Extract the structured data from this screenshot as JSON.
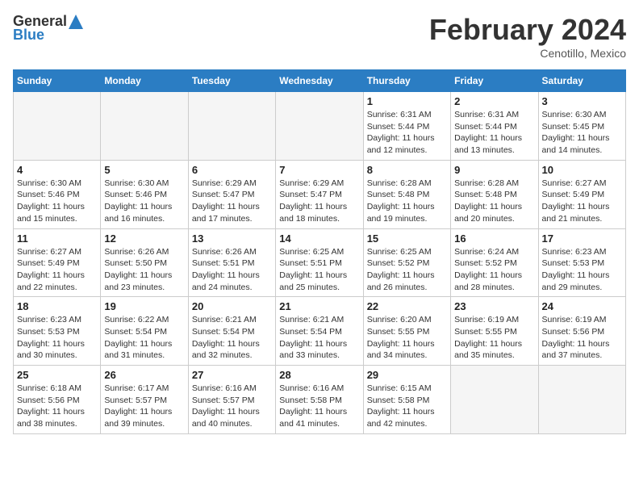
{
  "header": {
    "logo_general": "General",
    "logo_blue": "Blue",
    "month_title": "February 2024",
    "subtitle": "Cenotillo, Mexico"
  },
  "days_of_week": [
    "Sunday",
    "Monday",
    "Tuesday",
    "Wednesday",
    "Thursday",
    "Friday",
    "Saturday"
  ],
  "weeks": [
    [
      {
        "day": "",
        "info": ""
      },
      {
        "day": "",
        "info": ""
      },
      {
        "day": "",
        "info": ""
      },
      {
        "day": "",
        "info": ""
      },
      {
        "day": "1",
        "info": "Sunrise: 6:31 AM\nSunset: 5:44 PM\nDaylight: 11 hours and 12 minutes."
      },
      {
        "day": "2",
        "info": "Sunrise: 6:31 AM\nSunset: 5:44 PM\nDaylight: 11 hours and 13 minutes."
      },
      {
        "day": "3",
        "info": "Sunrise: 6:30 AM\nSunset: 5:45 PM\nDaylight: 11 hours and 14 minutes."
      }
    ],
    [
      {
        "day": "4",
        "info": "Sunrise: 6:30 AM\nSunset: 5:46 PM\nDaylight: 11 hours and 15 minutes."
      },
      {
        "day": "5",
        "info": "Sunrise: 6:30 AM\nSunset: 5:46 PM\nDaylight: 11 hours and 16 minutes."
      },
      {
        "day": "6",
        "info": "Sunrise: 6:29 AM\nSunset: 5:47 PM\nDaylight: 11 hours and 17 minutes."
      },
      {
        "day": "7",
        "info": "Sunrise: 6:29 AM\nSunset: 5:47 PM\nDaylight: 11 hours and 18 minutes."
      },
      {
        "day": "8",
        "info": "Sunrise: 6:28 AM\nSunset: 5:48 PM\nDaylight: 11 hours and 19 minutes."
      },
      {
        "day": "9",
        "info": "Sunrise: 6:28 AM\nSunset: 5:48 PM\nDaylight: 11 hours and 20 minutes."
      },
      {
        "day": "10",
        "info": "Sunrise: 6:27 AM\nSunset: 5:49 PM\nDaylight: 11 hours and 21 minutes."
      }
    ],
    [
      {
        "day": "11",
        "info": "Sunrise: 6:27 AM\nSunset: 5:49 PM\nDaylight: 11 hours and 22 minutes."
      },
      {
        "day": "12",
        "info": "Sunrise: 6:26 AM\nSunset: 5:50 PM\nDaylight: 11 hours and 23 minutes."
      },
      {
        "day": "13",
        "info": "Sunrise: 6:26 AM\nSunset: 5:51 PM\nDaylight: 11 hours and 24 minutes."
      },
      {
        "day": "14",
        "info": "Sunrise: 6:25 AM\nSunset: 5:51 PM\nDaylight: 11 hours and 25 minutes."
      },
      {
        "day": "15",
        "info": "Sunrise: 6:25 AM\nSunset: 5:52 PM\nDaylight: 11 hours and 26 minutes."
      },
      {
        "day": "16",
        "info": "Sunrise: 6:24 AM\nSunset: 5:52 PM\nDaylight: 11 hours and 28 minutes."
      },
      {
        "day": "17",
        "info": "Sunrise: 6:23 AM\nSunset: 5:53 PM\nDaylight: 11 hours and 29 minutes."
      }
    ],
    [
      {
        "day": "18",
        "info": "Sunrise: 6:23 AM\nSunset: 5:53 PM\nDaylight: 11 hours and 30 minutes."
      },
      {
        "day": "19",
        "info": "Sunrise: 6:22 AM\nSunset: 5:54 PM\nDaylight: 11 hours and 31 minutes."
      },
      {
        "day": "20",
        "info": "Sunrise: 6:21 AM\nSunset: 5:54 PM\nDaylight: 11 hours and 32 minutes."
      },
      {
        "day": "21",
        "info": "Sunrise: 6:21 AM\nSunset: 5:54 PM\nDaylight: 11 hours and 33 minutes."
      },
      {
        "day": "22",
        "info": "Sunrise: 6:20 AM\nSunset: 5:55 PM\nDaylight: 11 hours and 34 minutes."
      },
      {
        "day": "23",
        "info": "Sunrise: 6:19 AM\nSunset: 5:55 PM\nDaylight: 11 hours and 35 minutes."
      },
      {
        "day": "24",
        "info": "Sunrise: 6:19 AM\nSunset: 5:56 PM\nDaylight: 11 hours and 37 minutes."
      }
    ],
    [
      {
        "day": "25",
        "info": "Sunrise: 6:18 AM\nSunset: 5:56 PM\nDaylight: 11 hours and 38 minutes."
      },
      {
        "day": "26",
        "info": "Sunrise: 6:17 AM\nSunset: 5:57 PM\nDaylight: 11 hours and 39 minutes."
      },
      {
        "day": "27",
        "info": "Sunrise: 6:16 AM\nSunset: 5:57 PM\nDaylight: 11 hours and 40 minutes."
      },
      {
        "day": "28",
        "info": "Sunrise: 6:16 AM\nSunset: 5:58 PM\nDaylight: 11 hours and 41 minutes."
      },
      {
        "day": "29",
        "info": "Sunrise: 6:15 AM\nSunset: 5:58 PM\nDaylight: 11 hours and 42 minutes."
      },
      {
        "day": "",
        "info": ""
      },
      {
        "day": "",
        "info": ""
      }
    ]
  ]
}
